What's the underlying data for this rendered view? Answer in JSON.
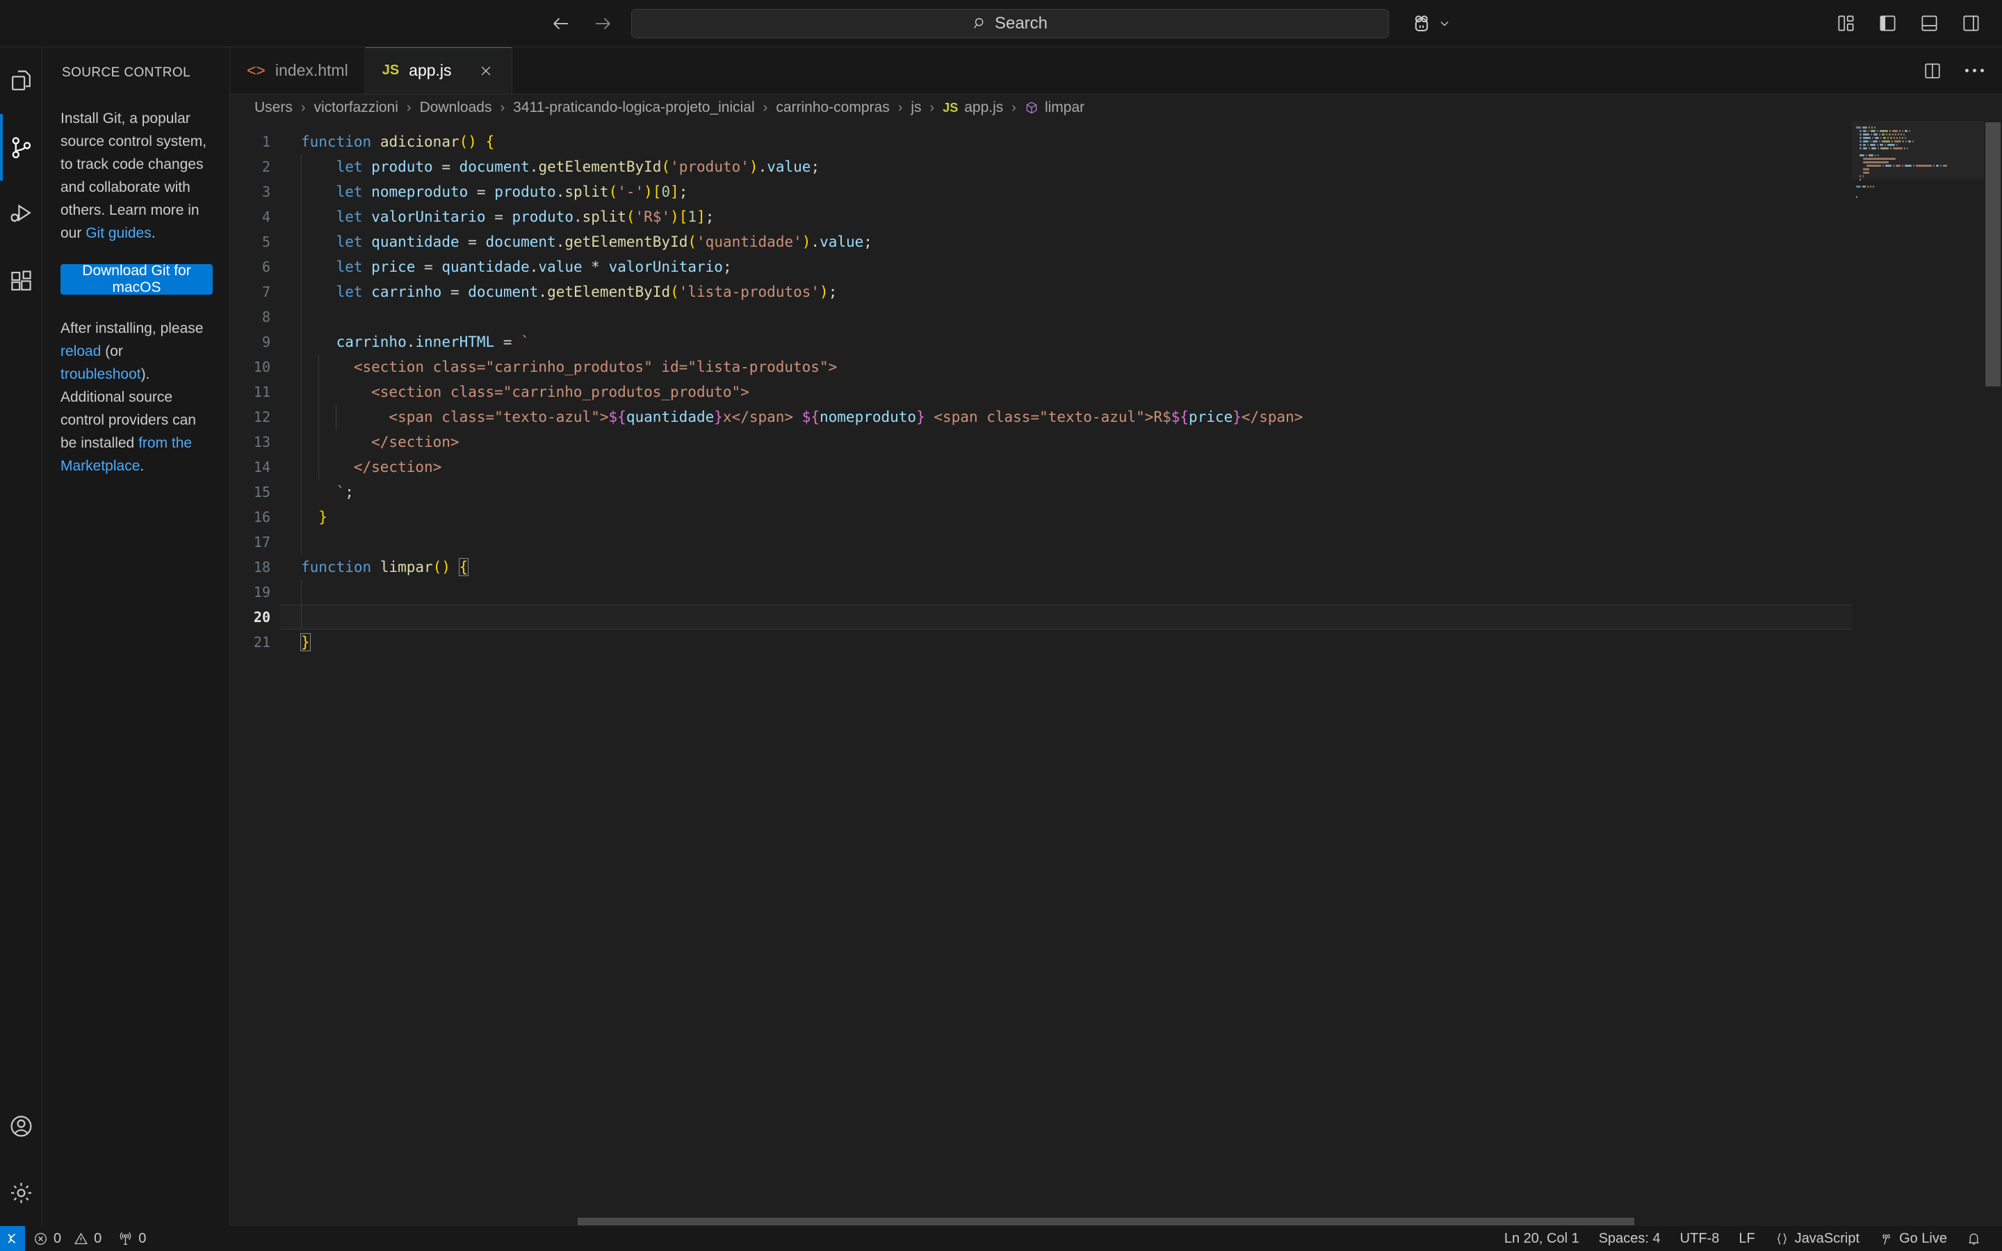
{
  "titlebar": {
    "back_icon": "arrow-left-icon",
    "forward_icon": "arrow-right-icon",
    "search_placeholder": "Search",
    "search_icon": "search-icon",
    "account_icon": "remote-account-icon",
    "chevron_icon": "chevron-down-icon",
    "layout_buttons": [
      {
        "name": "customize-layout-button",
        "icon": "layout-panel-icon"
      },
      {
        "name": "toggle-primary-sidebar-button",
        "icon": "primary-sidebar-icon"
      },
      {
        "name": "toggle-panel-button",
        "icon": "panel-icon"
      },
      {
        "name": "toggle-secondary-sidebar-button",
        "icon": "secondary-sidebar-icon"
      }
    ]
  },
  "activitybar": {
    "items": [
      {
        "name": "explorer",
        "icon": "files-icon",
        "active": false
      },
      {
        "name": "source-control",
        "icon": "source-control-icon",
        "active": true
      },
      {
        "name": "run-and-debug",
        "icon": "run-debug-icon",
        "active": false
      },
      {
        "name": "extensions",
        "icon": "extensions-icon",
        "active": false
      }
    ],
    "bottom_items": [
      {
        "name": "accounts",
        "icon": "account-icon"
      },
      {
        "name": "manage",
        "icon": "gear-icon"
      }
    ]
  },
  "sidebar": {
    "title": "SOURCE CONTROL",
    "paragraph1_a": "Install Git, a popular source control system, to track code changes and collaborate with others. Learn more in our ",
    "paragraph1_link": "Git guides",
    "paragraph1_b": ".",
    "download_button": "Download Git for macOS",
    "paragraph2_a": "After installing, please ",
    "paragraph2_link1": "reload",
    "paragraph2_b": " (or ",
    "paragraph2_link2": "troubleshoot",
    "paragraph2_c": "). Additional source control providers can be installed ",
    "paragraph2_link3": "from the Marketplace",
    "paragraph2_d": "."
  },
  "tabs": [
    {
      "label": "index.html",
      "icon": "html-file-icon",
      "icon_glyph": "<>",
      "active": false,
      "closeable": false
    },
    {
      "label": "app.js",
      "icon": "js-file-icon",
      "icon_glyph": "JS",
      "active": true,
      "closeable": true,
      "close_icon": "close-icon"
    }
  ],
  "editor_actions": [
    {
      "name": "split-editor-right-button",
      "icon": "split-editor-icon"
    },
    {
      "name": "more-actions-button",
      "icon": "ellipsis-icon"
    }
  ],
  "breadcrumb": [
    {
      "label": "Users",
      "icon": null
    },
    {
      "label": "victorfazzioni",
      "icon": null
    },
    {
      "label": "Downloads",
      "icon": null
    },
    {
      "label": "3411-praticando-logica-projeto_inicial",
      "icon": null
    },
    {
      "label": "carrinho-compras",
      "icon": null
    },
    {
      "label": "js",
      "icon": null
    },
    {
      "label": "app.js",
      "icon": "js-file-icon"
    },
    {
      "label": "limpar",
      "icon": "symbol-function-cube-icon"
    }
  ],
  "editor": {
    "language": "javascript",
    "total_lines": 21,
    "current_line": 20,
    "lines": [
      {
        "n": 1,
        "indent": 0,
        "tokens": [
          {
            "t": "function",
            "c": "kw"
          },
          {
            "t": " ",
            "c": "op"
          },
          {
            "t": "adicionar",
            "c": "fn"
          },
          {
            "t": "(",
            "c": "br1"
          },
          {
            "t": ")",
            "c": "br1"
          },
          {
            "t": " ",
            "c": "op"
          },
          {
            "t": "{",
            "c": "br1"
          }
        ]
      },
      {
        "n": 2,
        "indent": 1,
        "tokens": [
          {
            "t": "    ",
            "c": "op"
          },
          {
            "t": "let",
            "c": "kw"
          },
          {
            "t": " ",
            "c": "op"
          },
          {
            "t": "produto",
            "c": "var"
          },
          {
            "t": " = ",
            "c": "op"
          },
          {
            "t": "document",
            "c": "var"
          },
          {
            "t": ".",
            "c": "op"
          },
          {
            "t": "getElementById",
            "c": "fn"
          },
          {
            "t": "(",
            "c": "br1"
          },
          {
            "t": "'produto'",
            "c": "str"
          },
          {
            "t": ")",
            "c": "br1"
          },
          {
            "t": ".",
            "c": "op"
          },
          {
            "t": "value",
            "c": "var"
          },
          {
            "t": ";",
            "c": "op"
          }
        ]
      },
      {
        "n": 3,
        "indent": 1,
        "tokens": [
          {
            "t": "    ",
            "c": "op"
          },
          {
            "t": "let",
            "c": "kw"
          },
          {
            "t": " ",
            "c": "op"
          },
          {
            "t": "nomeproduto",
            "c": "var"
          },
          {
            "t": " = ",
            "c": "op"
          },
          {
            "t": "produto",
            "c": "var"
          },
          {
            "t": ".",
            "c": "op"
          },
          {
            "t": "split",
            "c": "fn"
          },
          {
            "t": "(",
            "c": "br1"
          },
          {
            "t": "'-'",
            "c": "str"
          },
          {
            "t": ")",
            "c": "br1"
          },
          {
            "t": "[",
            "c": "br1"
          },
          {
            "t": "0",
            "c": "num"
          },
          {
            "t": "]",
            "c": "br1"
          },
          {
            "t": ";",
            "c": "op"
          }
        ]
      },
      {
        "n": 4,
        "indent": 1,
        "tokens": [
          {
            "t": "    ",
            "c": "op"
          },
          {
            "t": "let",
            "c": "kw"
          },
          {
            "t": " ",
            "c": "op"
          },
          {
            "t": "valorUnitario",
            "c": "var"
          },
          {
            "t": " = ",
            "c": "op"
          },
          {
            "t": "produto",
            "c": "var"
          },
          {
            "t": ".",
            "c": "op"
          },
          {
            "t": "split",
            "c": "fn"
          },
          {
            "t": "(",
            "c": "br1"
          },
          {
            "t": "'R$'",
            "c": "str"
          },
          {
            "t": ")",
            "c": "br1"
          },
          {
            "t": "[",
            "c": "br1"
          },
          {
            "t": "1",
            "c": "num"
          },
          {
            "t": "]",
            "c": "br1"
          },
          {
            "t": ";",
            "c": "op"
          }
        ]
      },
      {
        "n": 5,
        "indent": 1,
        "tokens": [
          {
            "t": "    ",
            "c": "op"
          },
          {
            "t": "let",
            "c": "kw"
          },
          {
            "t": " ",
            "c": "op"
          },
          {
            "t": "quantidade",
            "c": "var"
          },
          {
            "t": " = ",
            "c": "op"
          },
          {
            "t": "document",
            "c": "var"
          },
          {
            "t": ".",
            "c": "op"
          },
          {
            "t": "getElementById",
            "c": "fn"
          },
          {
            "t": "(",
            "c": "br1"
          },
          {
            "t": "'quantidade'",
            "c": "str"
          },
          {
            "t": ")",
            "c": "br1"
          },
          {
            "t": ".",
            "c": "op"
          },
          {
            "t": "value",
            "c": "var"
          },
          {
            "t": ";",
            "c": "op"
          }
        ]
      },
      {
        "n": 6,
        "indent": 1,
        "tokens": [
          {
            "t": "    ",
            "c": "op"
          },
          {
            "t": "let",
            "c": "kw"
          },
          {
            "t": " ",
            "c": "op"
          },
          {
            "t": "price",
            "c": "var"
          },
          {
            "t": " = ",
            "c": "op"
          },
          {
            "t": "quantidade",
            "c": "var"
          },
          {
            "t": ".",
            "c": "op"
          },
          {
            "t": "value",
            "c": "var"
          },
          {
            "t": " * ",
            "c": "op"
          },
          {
            "t": "valorUnitario",
            "c": "var"
          },
          {
            "t": ";",
            "c": "op"
          }
        ]
      },
      {
        "n": 7,
        "indent": 1,
        "tokens": [
          {
            "t": "    ",
            "c": "op"
          },
          {
            "t": "let",
            "c": "kw"
          },
          {
            "t": " ",
            "c": "op"
          },
          {
            "t": "carrinho",
            "c": "var"
          },
          {
            "t": " = ",
            "c": "op"
          },
          {
            "t": "document",
            "c": "var"
          },
          {
            "t": ".",
            "c": "op"
          },
          {
            "t": "getElementById",
            "c": "fn"
          },
          {
            "t": "(",
            "c": "br1"
          },
          {
            "t": "'lista-produtos'",
            "c": "str"
          },
          {
            "t": ")",
            "c": "br1"
          },
          {
            "t": ";",
            "c": "op"
          }
        ]
      },
      {
        "n": 8,
        "indent": 1,
        "tokens": []
      },
      {
        "n": 9,
        "indent": 1,
        "tokens": [
          {
            "t": "    ",
            "c": "op"
          },
          {
            "t": "carrinho",
            "c": "var"
          },
          {
            "t": ".",
            "c": "op"
          },
          {
            "t": "innerHTML",
            "c": "var"
          },
          {
            "t": " = ",
            "c": "op"
          },
          {
            "t": "`",
            "c": "str"
          }
        ]
      },
      {
        "n": 10,
        "indent": 2,
        "tokens": [
          {
            "t": "      <section class=\"carrinho_produtos\" id=\"lista-produtos\">",
            "c": "str"
          }
        ]
      },
      {
        "n": 11,
        "indent": 2,
        "tokens": [
          {
            "t": "        <section class=\"carrinho_produtos_produto\">",
            "c": "str"
          }
        ]
      },
      {
        "n": 12,
        "indent": 3,
        "tokens": [
          {
            "t": "          <span class=\"texto-azul\">",
            "c": "str"
          },
          {
            "t": "${",
            "c": "br2"
          },
          {
            "t": "quantidade",
            "c": "var"
          },
          {
            "t": "}",
            "c": "br2"
          },
          {
            "t": "x</span> ",
            "c": "str"
          },
          {
            "t": "${",
            "c": "br2"
          },
          {
            "t": "nomeproduto",
            "c": "var"
          },
          {
            "t": "}",
            "c": "br2"
          },
          {
            "t": " <span class=\"texto-azul\">R$",
            "c": "str"
          },
          {
            "t": "${",
            "c": "br2"
          },
          {
            "t": "price",
            "c": "var"
          },
          {
            "t": "}",
            "c": "br2"
          },
          {
            "t": "</span>",
            "c": "str"
          }
        ]
      },
      {
        "n": 13,
        "indent": 2,
        "tokens": [
          {
            "t": "        </section>",
            "c": "str"
          }
        ]
      },
      {
        "n": 14,
        "indent": 2,
        "tokens": [
          {
            "t": "      </section>",
            "c": "str"
          }
        ]
      },
      {
        "n": 15,
        "indent": 1,
        "tokens": [
          {
            "t": "    `",
            "c": "str"
          },
          {
            "t": ";",
            "c": "op"
          }
        ]
      },
      {
        "n": 16,
        "indent": 1,
        "tokens": [
          {
            "t": "  ",
            "c": "op"
          },
          {
            "t": "}",
            "c": "br1"
          }
        ]
      },
      {
        "n": 17,
        "indent": 1,
        "tokens": []
      },
      {
        "n": 18,
        "indent": 0,
        "tokens": [
          {
            "t": "function",
            "c": "kw"
          },
          {
            "t": " ",
            "c": "op"
          },
          {
            "t": "limpar",
            "c": "fn"
          },
          {
            "t": "(",
            "c": "br1"
          },
          {
            "t": ")",
            "c": "br1"
          },
          {
            "t": " ",
            "c": "op"
          },
          {
            "t": "{",
            "c": "br1",
            "match": true
          }
        ]
      },
      {
        "n": 19,
        "indent": 1,
        "tokens": []
      },
      {
        "n": 20,
        "indent": 1,
        "tokens": [],
        "current": true
      },
      {
        "n": 21,
        "indent": 0,
        "tokens": [
          {
            "t": "}",
            "c": "br1",
            "match": true
          }
        ]
      }
    ]
  },
  "statusbar": {
    "remote_icon": "remote-window-icon",
    "errors_icon": "error-icon",
    "errors": "0",
    "warnings_icon": "warning-icon",
    "warnings": "0",
    "ports_icon": "radio-tower-icon",
    "ports": "0",
    "cursor_position": "Ln 20, Col 1",
    "indentation": "Spaces: 4",
    "encoding": "UTF-8",
    "eol": "LF",
    "language_icon": "braces-icon",
    "language": "JavaScript",
    "golive_icon": "broadcast-icon",
    "golive": "Go Live",
    "notifications_icon": "bell-icon"
  },
  "colors": {
    "accent": "#0078d4",
    "titlebar_bg": "#181818",
    "editor_bg": "#1f1f1f",
    "link": "#4daafc",
    "js_icon": "#cbcb41",
    "html_icon": "#e37933"
  }
}
